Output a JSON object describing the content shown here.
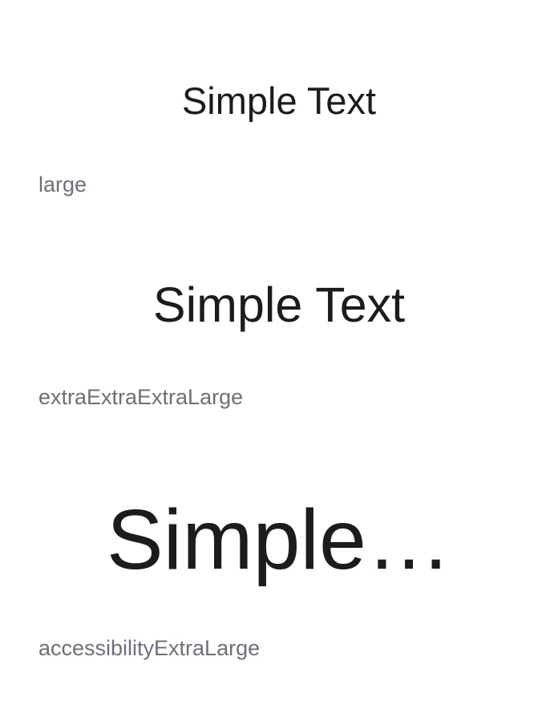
{
  "rows": [
    {
      "sample_text": "Simple Text",
      "size_label": "large"
    },
    {
      "sample_text": "Simple Text",
      "size_label": "extraExtraExtraLarge"
    },
    {
      "sample_text": "Simple…",
      "size_label": "accessibilityExtraLarge"
    }
  ],
  "colors": {
    "text": "#1c1c1e",
    "label": "#6b7079",
    "background": "#ffffff"
  }
}
